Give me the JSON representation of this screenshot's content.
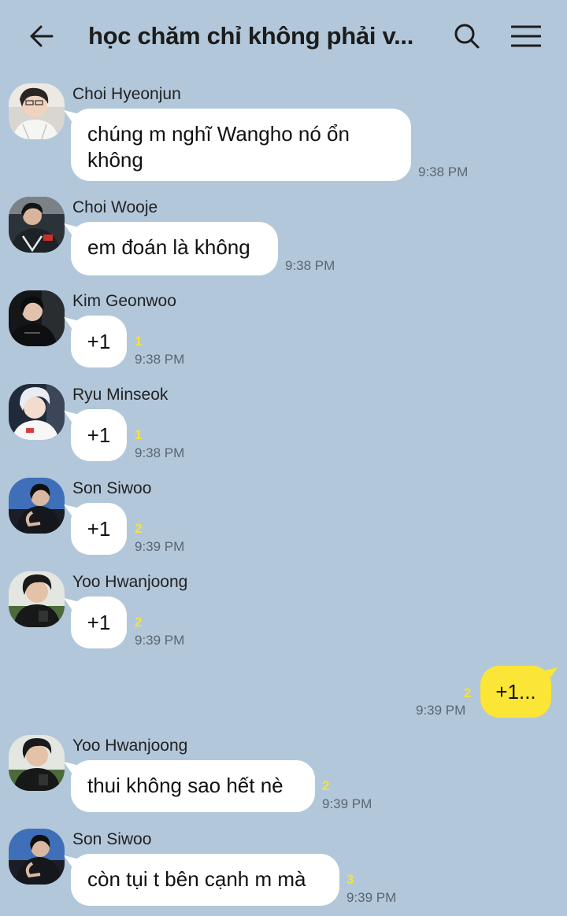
{
  "header": {
    "title": "học chăm chỉ không phải v...",
    "back_icon": "arrow-left-icon",
    "search_icon": "search-icon",
    "menu_icon": "hamburger-menu-icon"
  },
  "messages": [
    {
      "sender": "Choi Hyeonjun",
      "text": "chúng m nghĩ Wangho nó ổn\nkhông",
      "time": "9:38 PM",
      "unread": ""
    },
    {
      "sender": "Choi Wooje",
      "text": "em đoán là không",
      "time": "9:38 PM",
      "unread": ""
    },
    {
      "sender": "Kim Geonwoo",
      "text": "+1",
      "time": "9:38 PM",
      "unread": "1"
    },
    {
      "sender": "Ryu Minseok",
      "text": "+1",
      "time": "9:38 PM",
      "unread": "1"
    },
    {
      "sender": "Son Siwoo",
      "text": "+1",
      "time": "9:39 PM",
      "unread": "2"
    },
    {
      "sender": "Yoo Hwanjoong",
      "text": "+1",
      "time": "9:39 PM",
      "unread": "2"
    },
    {
      "sender": "",
      "text": "+1...",
      "time": "9:39 PM",
      "unread": "2",
      "outgoing": true
    },
    {
      "sender": "Yoo Hwanjoong",
      "text": "thui không sao hết nè",
      "time": "9:39 PM",
      "unread": "2"
    },
    {
      "sender": "Son Siwoo",
      "text": "còn tụi t bên cạnh m mà",
      "time": "9:39 PM",
      "unread": "3"
    }
  ],
  "colors": {
    "background": "#b2c7da",
    "incoming_bubble": "#ffffff",
    "outgoing_bubble": "#fbe536",
    "unread_count": "#f5e23a"
  }
}
